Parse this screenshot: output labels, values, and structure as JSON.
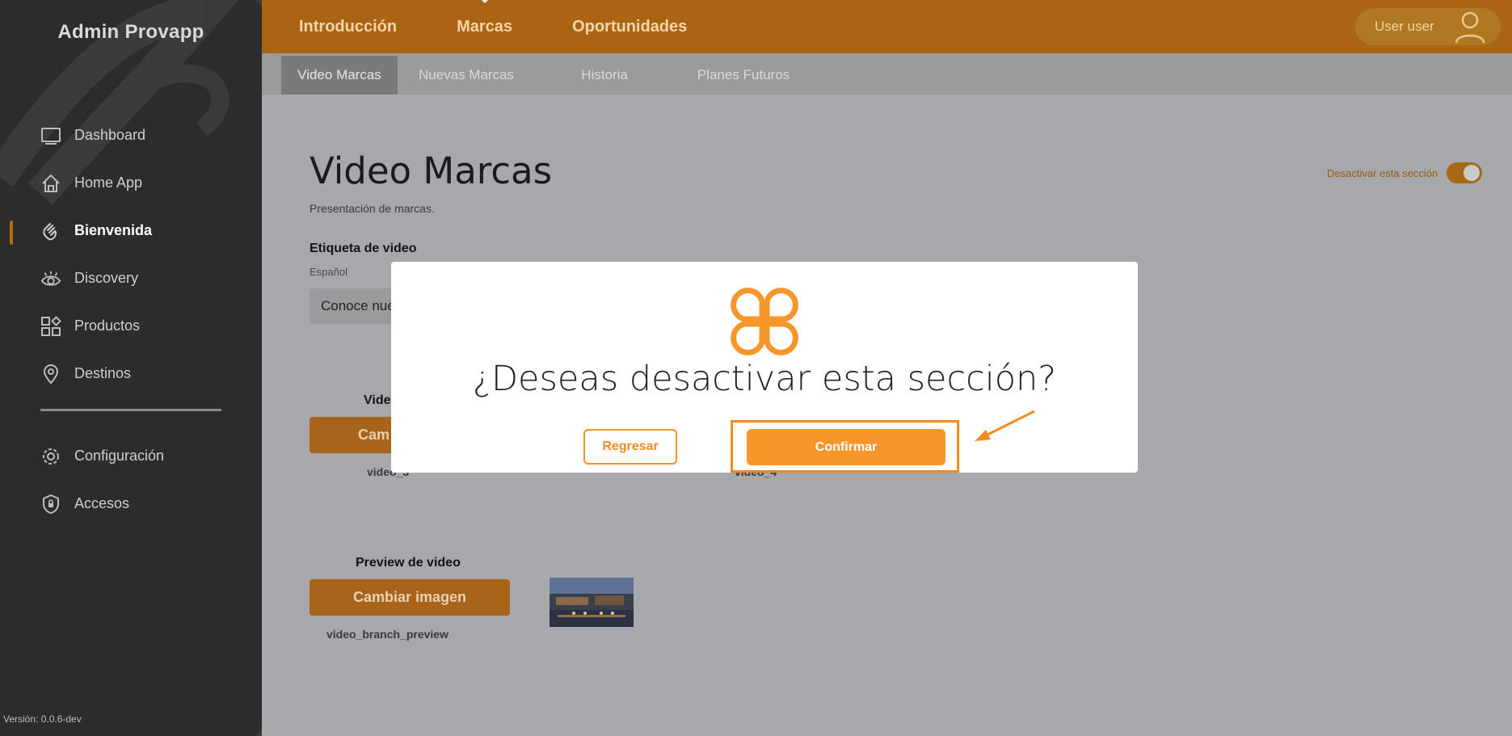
{
  "sidebar": {
    "brand": "Admin Provapp",
    "items": [
      {
        "label": "Dashboard",
        "icon": "monitor-icon"
      },
      {
        "label": "Home App",
        "icon": "home-icon"
      },
      {
        "label": "Bienvenida",
        "icon": "waving-hand-icon",
        "active": true
      },
      {
        "label": "Discovery",
        "icon": "eye-icon"
      },
      {
        "label": "Productos",
        "icon": "grid-shapes-icon"
      },
      {
        "label": "Destinos",
        "icon": "map-pin-icon"
      }
    ],
    "secondary_items": [
      {
        "label": "Configuración",
        "icon": "gear-icon"
      },
      {
        "label": "Accesos",
        "icon": "shield-lock-icon"
      }
    ],
    "version": "Versión: 0.0.6-dev"
  },
  "topbar": {
    "tabs": [
      "Introducción",
      "Marcas",
      "Oportunidades"
    ],
    "active_tab": "Marcas",
    "user_label": "User user"
  },
  "subnav": {
    "tabs": [
      "Video Marcas",
      "Nuevas Marcas",
      "Historia",
      "Planes Futuros"
    ],
    "active": "Video Marcas"
  },
  "main": {
    "title": "Video Marcas",
    "subtitle": "Presentación de marcas.",
    "toggle_label": "Desactivar esta sección",
    "toggle_on": true,
    "video_label_heading": "Etiqueta de video",
    "language_label": "Español",
    "input_value": "Conoce nue",
    "video_col1_heading": "Vide",
    "video_col1_button": "Cam",
    "video_col1_file": "video_3",
    "video_col2_file": "video_4",
    "preview_heading": "Preview de video",
    "preview_button": "Cambiar imagen",
    "preview_file": "video_branch_preview"
  },
  "modal": {
    "title": "¿Deseas desactivar esta sección?",
    "back_button": "Regresar",
    "confirm_button": "Confirmar"
  },
  "colors": {
    "accent": "#f7962b",
    "topbar": "#aa6414",
    "sidebar": "#2c2c2c",
    "highlight": "#f58a1e"
  }
}
